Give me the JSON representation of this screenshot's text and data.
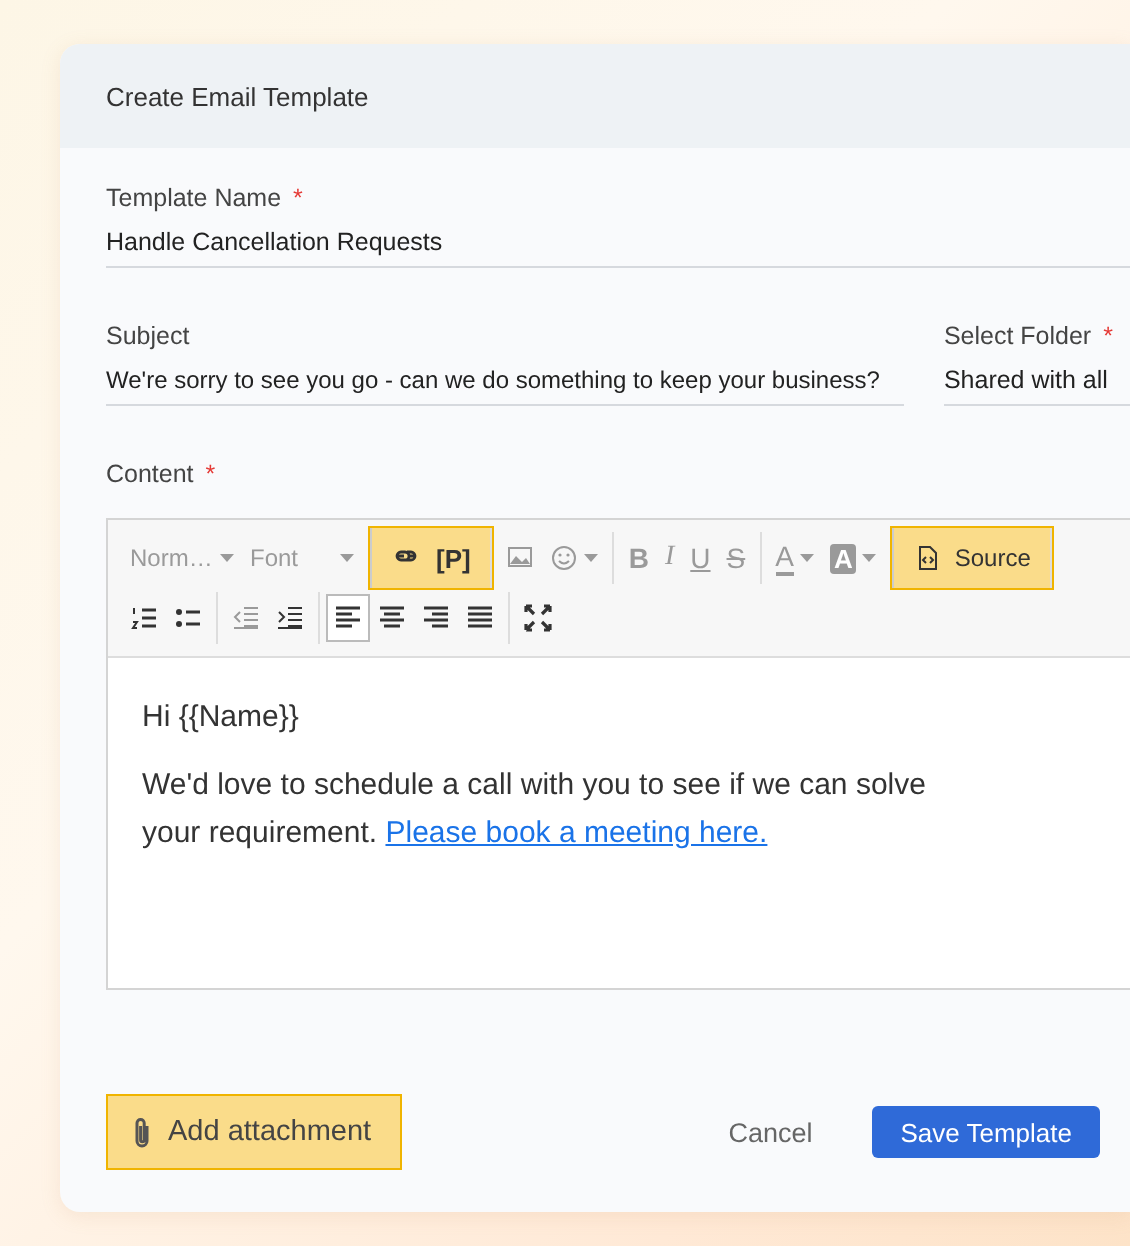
{
  "dialog": {
    "title": "Create Email Template"
  },
  "fields": [
    {
      "label": "Template Name",
      "required_mark": "*",
      "value": "Handle Cancellation Requests"
    },
    {
      "label": "Subject",
      "value": "We're sorry to see you go - can we do something to keep your business?"
    },
    {
      "label": "Select Folder",
      "required_mark": "*",
      "value": "Shared with all"
    }
  ],
  "content": {
    "label": "Content",
    "required_mark": "*",
    "toolbar": [
      [
        {
          "highlighted": false,
          "items": [
            {
              "kind": "dropdown",
              "label": "Norm…",
              "disabled": true
            },
            {
              "kind": "dropdown",
              "label": "Font",
              "disabled": true
            }
          ]
        },
        {
          "highlighted": true,
          "items": [
            {
              "kind": "link",
              "disabled": false
            },
            {
              "kind": "text",
              "label": "[P]",
              "disabled": false
            }
          ]
        },
        {
          "highlighted": false,
          "items": [
            {
              "kind": "image",
              "disabled": true
            },
            {
              "kind": "emoji",
              "disabled": true
            }
          ]
        },
        {
          "highlighted": false,
          "items": [
            {
              "kind": "bold",
              "label": "B",
              "disabled": true
            },
            {
              "kind": "italic",
              "label": "I",
              "disabled": true
            },
            {
              "kind": "underline",
              "label": "U",
              "disabled": true
            },
            {
              "kind": "strike",
              "label": "S",
              "disabled": true
            }
          ]
        },
        {
          "highlighted": false,
          "items": [
            {
              "kind": "textcolor",
              "label": "A",
              "disabled": true
            },
            {
              "kind": "bgcolor",
              "label": "A",
              "disabled": true
            }
          ]
        },
        {
          "highlighted": true,
          "items": [
            {
              "kind": "source",
              "label": "Source",
              "disabled": false
            }
          ]
        }
      ],
      [
        {
          "highlighted": false,
          "items": [
            {
              "kind": "numbered",
              "disabled": false
            },
            {
              "kind": "bulleted",
              "disabled": false
            }
          ]
        },
        {
          "highlighted": false,
          "items": [
            {
              "kind": "outdent",
              "disabled": true
            },
            {
              "kind": "indent",
              "disabled": false
            }
          ]
        },
        {
          "highlighted": false,
          "items": [
            {
              "kind": "alignleft",
              "disabled": false,
              "selected": true
            },
            {
              "kind": "aligncenter",
              "disabled": false,
              "selected": false
            },
            {
              "kind": "alignright",
              "disabled": false,
              "selected": false
            },
            {
              "kind": "justify",
              "disabled": false,
              "selected": false
            }
          ]
        },
        {
          "highlighted": false,
          "items": [
            {
              "kind": "maximize",
              "disabled": false
            }
          ]
        }
      ]
    ],
    "paragraphs": [
      {
        "text": "Hi {{Name}}"
      },
      {
        "text": "We'd love to schedule a call with you to see if we can solve your requirement.",
        "link": "Please book a meeting here."
      }
    ]
  },
  "footer": {
    "attachment": {
      "label": "Add attachment",
      "highlighted": true
    },
    "cancel": "Cancel",
    "save": "Save Template"
  }
}
